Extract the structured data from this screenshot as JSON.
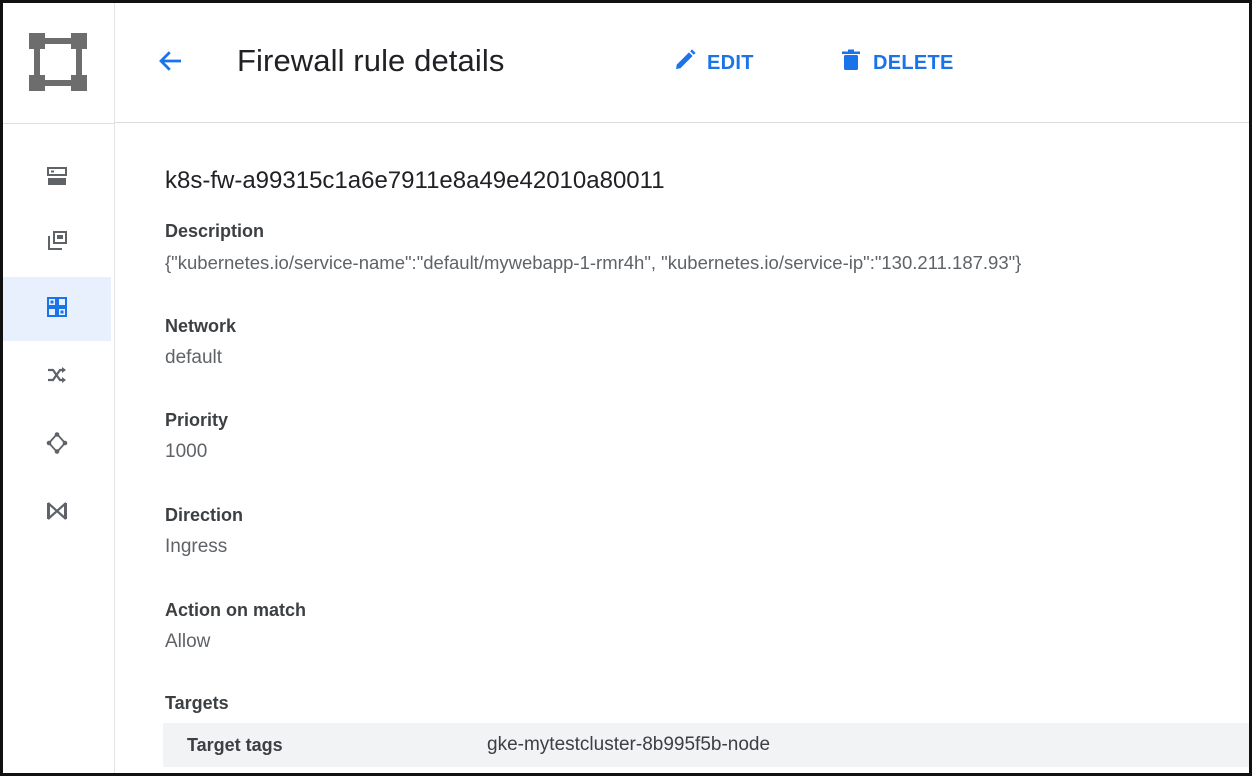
{
  "header": {
    "title": "Firewall rule details",
    "edit_label": "EDIT",
    "delete_label": "DELETE"
  },
  "rail": {
    "items": [
      {
        "icon": "servers-icon"
      },
      {
        "icon": "external-window-icon"
      },
      {
        "icon": "firewall-grid-icon",
        "active": true
      },
      {
        "icon": "shuffle-routes-icon"
      },
      {
        "icon": "network-nodes-icon"
      },
      {
        "icon": "bowtie-peering-icon"
      }
    ]
  },
  "rule": {
    "name": "k8s-fw-a99315c1a6e7911e8a49e42010a80011",
    "fields": [
      {
        "label": "Description",
        "value": "{\"kubernetes.io/service-name\":\"default/mywebapp-1-rmr4h\", \"kubernetes.io/service-ip\":\"130.211.187.93\"}"
      },
      {
        "label": "Network",
        "value": "default"
      },
      {
        "label": "Priority",
        "value": "1000"
      },
      {
        "label": "Direction",
        "value": "Ingress"
      },
      {
        "label": "Action on match",
        "value": "Allow"
      }
    ],
    "targets": {
      "label": "Targets",
      "key": "Target tags",
      "value": "gke-mytestcluster-8b995f5b-node"
    }
  },
  "colors": {
    "accent": "#1a73e8",
    "active_bg": "#e8f0fe",
    "icon_gray": "#5f6368",
    "logo_gray": "#6d6d6d"
  }
}
